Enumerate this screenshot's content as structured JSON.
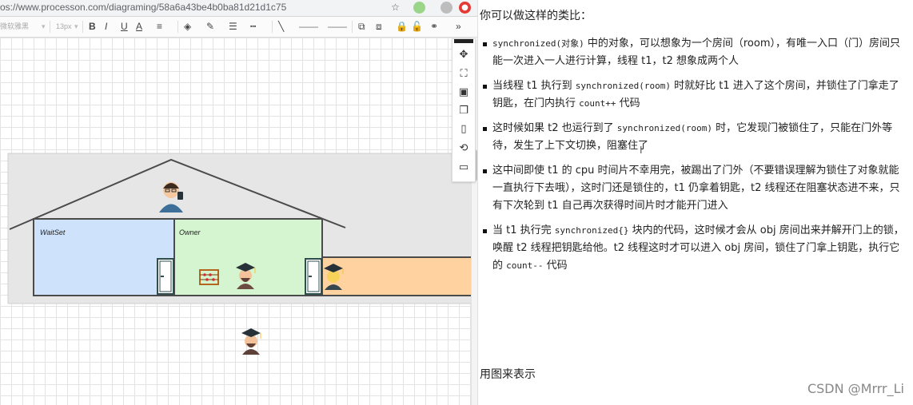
{
  "browser": {
    "url": "os://www.processon.com/diagraming/58a6a43be4b0ba81d21d1c75",
    "icons": [
      "star-icon",
      "extension-icon",
      "profile-icon",
      "extension-red-icon"
    ]
  },
  "toolbar": {
    "font_family": "微软雅黑",
    "font_size": "13px",
    "bold": "B",
    "italic": "I",
    "underline": "U",
    "font_color": "A"
  },
  "diagram": {
    "waitset_label": "WaitSet",
    "owner_label": "Owner",
    "colors": {
      "house_bg": "#e6e6e6",
      "waitset": "#cfe2fb",
      "owner": "#d4f5cf",
      "corridor": "#ffd2a0",
      "outline": "#4b4b4b"
    }
  },
  "notes": {
    "intro": "你可以做这样的类比：",
    "points": [
      {
        "parts": [
          {
            "t": "synchronized(对象)",
            "code": true
          },
          {
            "t": " 中的对象，可以想象为一个房间（room），有唯一入口（门）房间只能一次进入一人进行计算，线程 t1，t2 想象成两个人"
          }
        ]
      },
      {
        "parts": [
          {
            "t": "当线程 t1 执行到 "
          },
          {
            "t": "synchronized(room)",
            "code": true
          },
          {
            "t": " 时就好比 t1 进入了这个房间，并锁住了门拿走了钥匙，在门内执行 "
          },
          {
            "t": "count++",
            "code": true
          },
          {
            "t": " 代码"
          }
        ]
      },
      {
        "parts": [
          {
            "t": "这时候如果 t2 也运行到了 "
          },
          {
            "t": "synchronized(room)",
            "code": true
          },
          {
            "t": " 时，它发现门被锁住了，只能在门外等待，发生了上下文切换，阻塞住了"
          }
        ]
      },
      {
        "parts": [
          {
            "t": "这中间即使 t1 的 cpu 时间片不幸用完，被踢出了门外（不要错误理解为锁住了对象就能一直执行下去哦），这时门还是锁住的，t1 仍拿着钥匙，t2 线程还在阻塞状态进不来，只有下次轮到 t1 自己再次获得时间片时才能开门进入"
          }
        ]
      },
      {
        "parts": [
          {
            "t": "当 t1 执行完 "
          },
          {
            "t": "synchronized{}",
            "code": true
          },
          {
            "t": " 块内的代码，这时候才会从 obj 房间出来并解开门上的锁，唤醒 t2 线程把钥匙给他。t2 线程这时才可以进入 obj 房间，锁住了门拿上钥匙，执行它的 "
          },
          {
            "t": "count--",
            "code": true
          },
          {
            "t": " 代码"
          }
        ]
      }
    ],
    "outro": "用图来表示",
    "watermark": "CSDN @Mrrr_Li"
  }
}
